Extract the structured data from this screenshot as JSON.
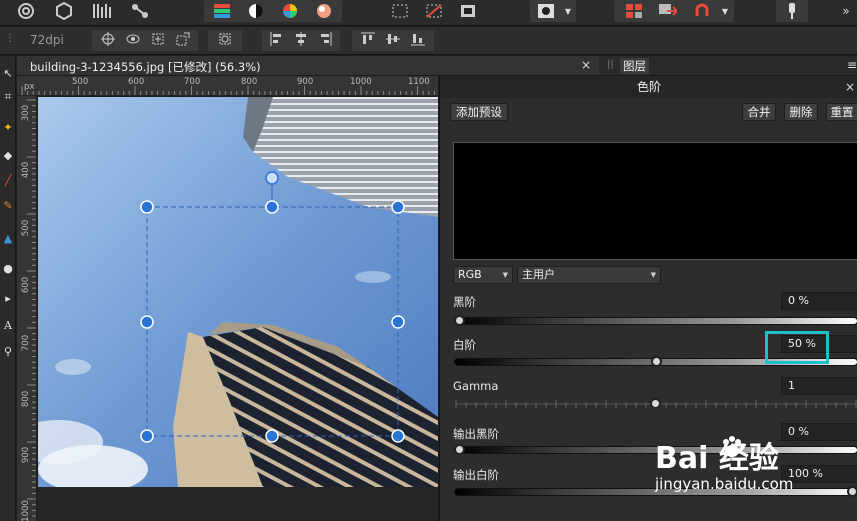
{
  "context_toolbar": {
    "dpi": "72dpi"
  },
  "document": {
    "tab_title": "building-3-1234556.jpg [已修改] (56.3%)",
    "close_glyph": "×"
  },
  "ruler": {
    "unit": "px",
    "top_labels": [
      "500",
      "600",
      "700",
      "800",
      "900",
      "1000",
      "1100"
    ],
    "left_labels": [
      "300",
      "400",
      "500",
      "600",
      "700",
      "800",
      "900",
      "1000"
    ]
  },
  "panel_tabs": {
    "layers": "图层"
  },
  "levels_panel": {
    "title": "色阶",
    "close_glyph": "×",
    "add_preset": "添加预设",
    "merge": "合并",
    "delete": "删除",
    "reset": "重置",
    "channel": "RGB",
    "source": "主用户",
    "black_level": {
      "label": "黑阶",
      "value": "0 %",
      "position": 0.0
    },
    "white_level": {
      "label": "白阶",
      "value": "50 %",
      "position": 0.5
    },
    "gamma": {
      "label": "Gamma",
      "value": "1",
      "position": 0.5
    },
    "output_black": {
      "label": "输出黑阶",
      "value": "0 %",
      "position": 0.0
    },
    "output_white": {
      "label": "输出白阶",
      "value": "100 %",
      "position": 1.0
    }
  },
  "highlight_color": "#19c1c9",
  "watermark": {
    "brand": "Bai 经验",
    "url": "jingyan.baidu.com"
  }
}
